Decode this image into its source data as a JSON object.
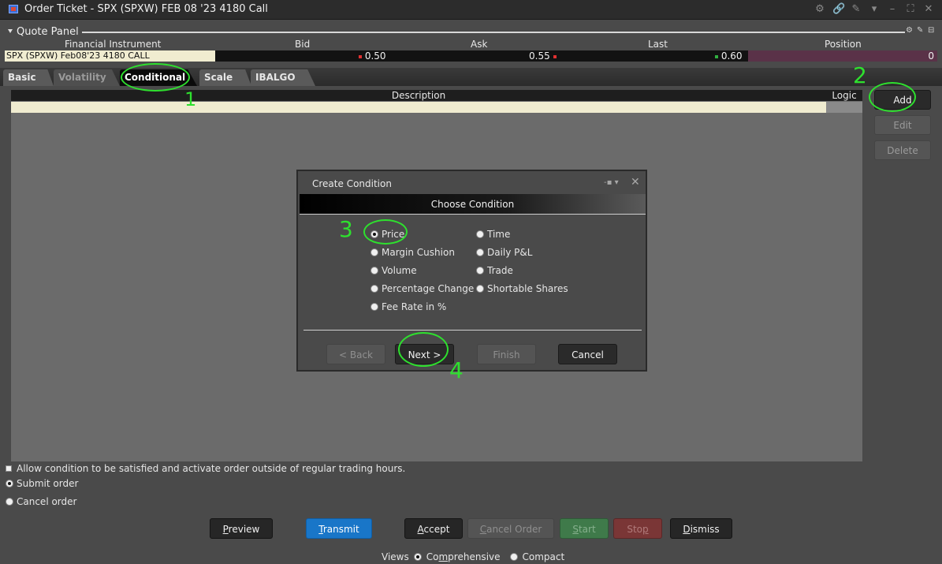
{
  "window": {
    "title": "Order Ticket - SPX (SPXW) FEB 08 '23 4180 Call"
  },
  "quote_panel": {
    "title": "Quote Panel",
    "columns": [
      "Financial Instrument",
      "Bid",
      "Ask",
      "Last",
      "Position"
    ],
    "row": {
      "instrument": "SPX (SPXW) Feb08'23 4180 CALL",
      "bid": "0.50",
      "ask": "0.55",
      "last": "0.60",
      "position": "0"
    },
    "colors": {
      "bid_dot": "#e03030",
      "ask_dot": "#e03030",
      "last_dot": "#30b040",
      "position_bg": "#5a3248"
    }
  },
  "tabs": [
    {
      "label": "Basic"
    },
    {
      "label": "Volatility"
    },
    {
      "label": "Conditional"
    },
    {
      "label": "Scale"
    },
    {
      "label": "IBALGO"
    }
  ],
  "conditions_table": {
    "headers": {
      "description": "Description",
      "logic": "Logic"
    }
  },
  "side_buttons": {
    "add": "Add",
    "edit": "Edit",
    "delete": "Delete"
  },
  "dialog": {
    "title": "Create Condition",
    "heading": "Choose Condition",
    "options_left": [
      "Price",
      "Margin Cushion",
      "Volume",
      "Percentage Change",
      "Fee Rate in %"
    ],
    "options_right": [
      "Time",
      "Daily P&L",
      "Trade",
      "Shortable Shares"
    ],
    "selected": "Price",
    "buttons": {
      "back": "< Back",
      "next": "Next >",
      "finish": "Finish",
      "cancel": "Cancel"
    }
  },
  "annotations": {
    "n1": "1",
    "n2": "2",
    "n3": "3",
    "n4": "4",
    "color": "#2ee02e"
  },
  "options": {
    "allow_outside_rth": "Allow condition to be satisfied and activate order outside of regular trading hours.",
    "submit_order": "Submit order",
    "cancel_order": "Cancel order"
  },
  "bottom_buttons": {
    "preview_first": "P",
    "preview_rest": "review",
    "transmit_first": "T",
    "transmit_rest": "ransmit",
    "accept_first": "A",
    "accept_rest": "ccept",
    "cancel_order_first": "C",
    "cancel_order_rest": "ancel Order",
    "start_first": "S",
    "start_rest": "tart",
    "stop_first": "Sto",
    "stop_under": "p",
    "dismiss_first": "D",
    "dismiss_rest": "ismiss"
  },
  "views": {
    "label": "Views",
    "comprehensive_a": "Co",
    "comprehensive_u": "m",
    "comprehensive_b": "prehensive",
    "compact": "Compact"
  }
}
